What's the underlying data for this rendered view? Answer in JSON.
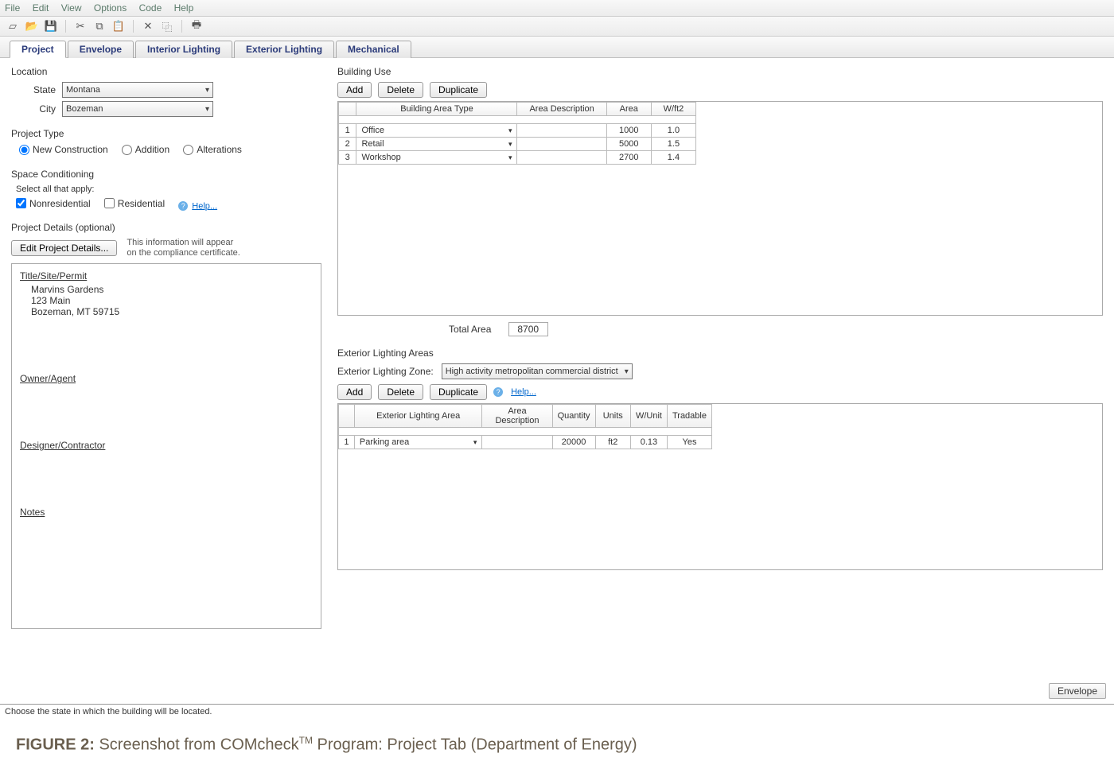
{
  "menu": {
    "file": "File",
    "edit": "Edit",
    "view": "View",
    "options": "Options",
    "code": "Code",
    "help": "Help"
  },
  "tabs": {
    "project": "Project",
    "envelope": "Envelope",
    "interior": "Interior Lighting",
    "exterior": "Exterior Lighting",
    "mechanical": "Mechanical"
  },
  "location": {
    "heading": "Location",
    "state_label": "State",
    "state_value": "Montana",
    "city_label": "City",
    "city_value": "Bozeman"
  },
  "project_type": {
    "heading": "Project Type",
    "new_con": "New Construction",
    "addition": "Addition",
    "alterations": "Alterations"
  },
  "space_cond": {
    "heading": "Space Conditioning",
    "select_all": "Select all that apply:",
    "nonres": "Nonresidential",
    "res": "Residential",
    "help": "Help..."
  },
  "proj_details": {
    "heading": "Project Details (optional)",
    "edit_btn": "Edit Project Details...",
    "note1": "This information will appear",
    "note2": "on the compliance certificate.",
    "title_sect": "Title/Site/Permit",
    "line1": "Marvins Gardens",
    "line2": "123 Main",
    "line3": "Bozeman, MT  59715",
    "owner_sect": "Owner/Agent",
    "designer_sect": "Designer/Contractor",
    "notes_sect": "Notes"
  },
  "building_use": {
    "heading": "Building Use",
    "add": "Add",
    "del": "Delete",
    "dup": "Duplicate",
    "col_type": "Building Area Type",
    "col_desc": "Area Description",
    "col_area": "Area",
    "col_wft2": "W/ft2",
    "rows": [
      {
        "n": "1",
        "type": "Office",
        "desc": "",
        "area": "1000",
        "w": "1.0"
      },
      {
        "n": "2",
        "type": "Retail",
        "desc": "",
        "area": "5000",
        "w": "1.5"
      },
      {
        "n": "3",
        "type": "Workshop",
        "desc": "",
        "area": "2700",
        "w": "1.4"
      }
    ],
    "total_label": "Total Area",
    "total_value": "8700"
  },
  "ext_lighting": {
    "heading": "Exterior Lighting Areas",
    "zone_label": "Exterior Lighting Zone:",
    "zone_value": "High activity metropolitan commercial district",
    "add": "Add",
    "del": "Delete",
    "dup": "Duplicate",
    "help": "Help...",
    "col_area": "Exterior Lighting Area",
    "col_desc": "Area Description",
    "col_qty": "Quantity",
    "col_units": "Units",
    "col_wunit": "W/Unit",
    "col_trade": "Tradable",
    "rows": [
      {
        "n": "1",
        "area": "Parking area",
        "desc": "",
        "qty": "20000",
        "units": "ft2",
        "wunit": "0.13",
        "trade": "Yes"
      }
    ]
  },
  "footer": {
    "envelope_btn": "Envelope"
  },
  "statusbar": "Choose the state in which the building will be located.",
  "caption_prefix": "FIGURE 2:",
  "caption_text": " Screenshot from COMcheck",
  "caption_suffix": " Program: Project Tab (Department of Energy)"
}
